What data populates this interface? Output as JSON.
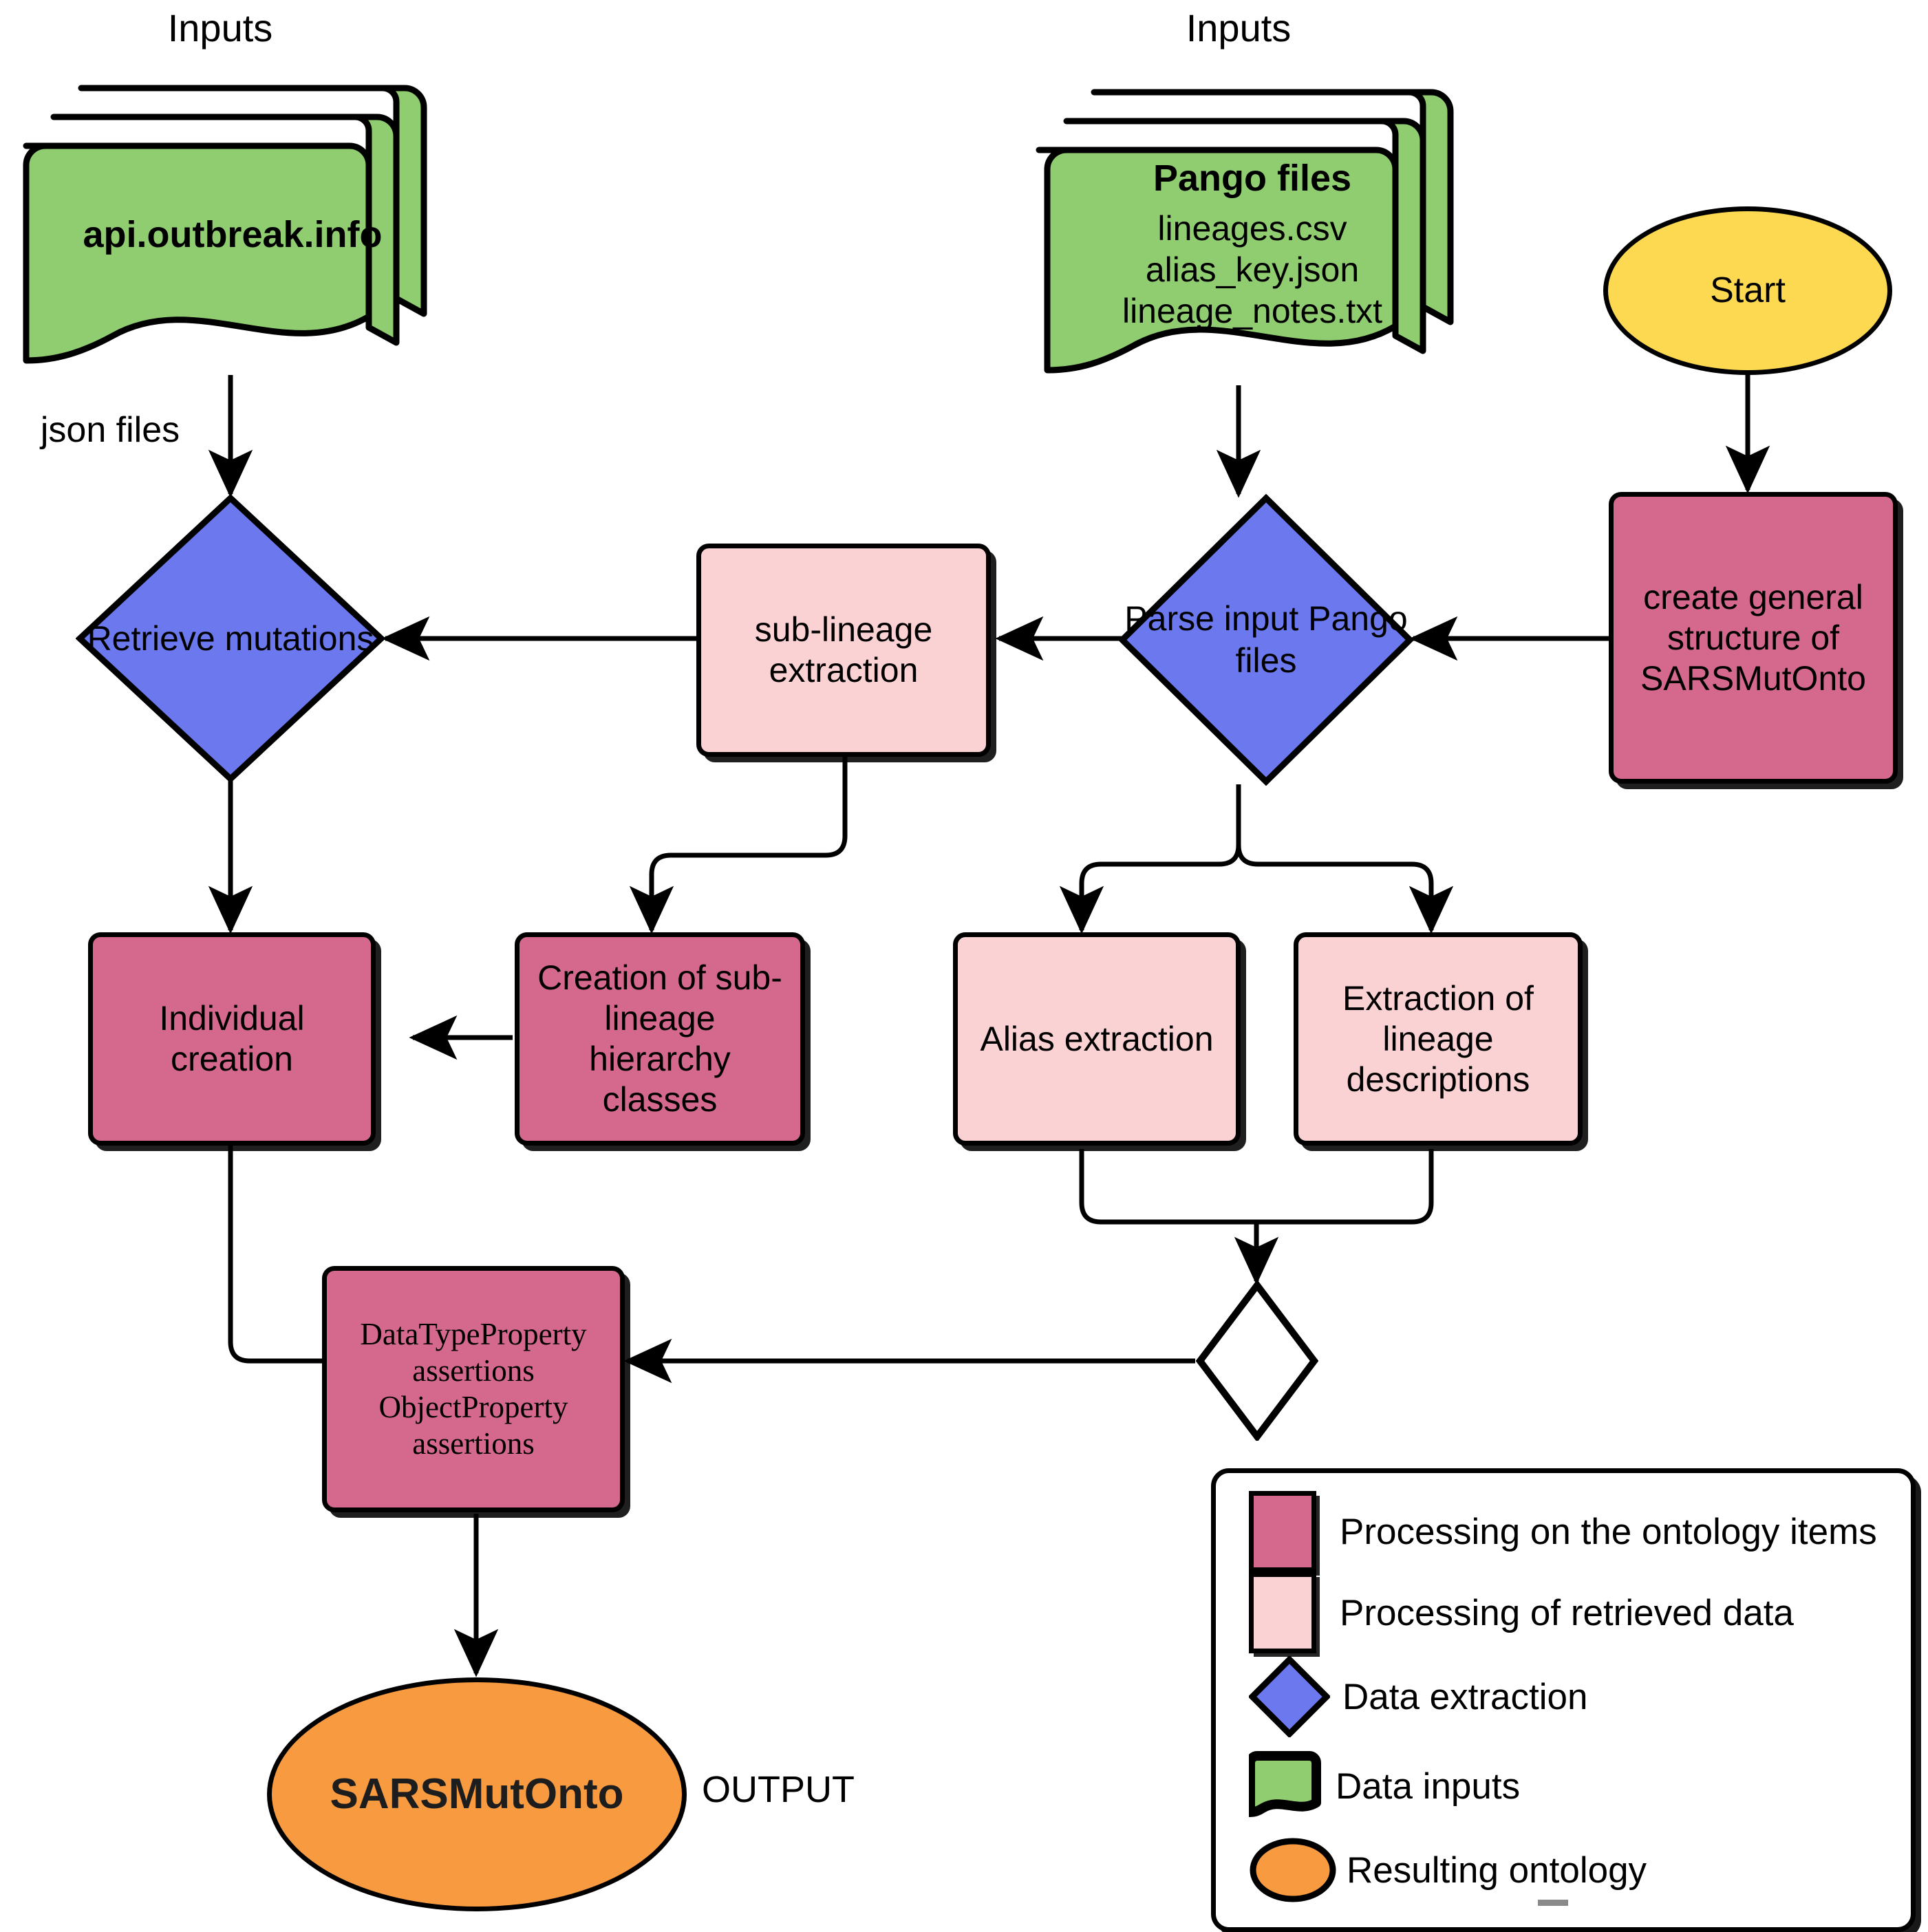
{
  "diagram": {
    "title": "SARSMutOnto construction workflow",
    "colors": {
      "ontology_processing": "#d4698d",
      "retrieved_processing": "#fbd2d4",
      "data_extraction": "#6b78ee",
      "data_input": "#90cc70",
      "start": "#fcd950",
      "result": "#f79a40",
      "stroke": "#000000"
    }
  },
  "inputs": {
    "left_caption": "Inputs",
    "right_caption": "Inputs",
    "outbreak": {
      "title": "api.outbreak.info"
    },
    "pango": {
      "title": "Pango files",
      "files": [
        "lineages.csv",
        "alias_key.json",
        "lineage_notes.txt"
      ]
    },
    "json_files_label": "json files"
  },
  "nodes": {
    "start": "Start",
    "create_structure": "create general structure of SARSMutOnto",
    "parse_pango": "Parse input Pango files",
    "sub_lineage_extraction": "sub-lineage extraction",
    "retrieve_mutations": "Retrieve mutations",
    "alias_extraction": "Alias extraction",
    "lineage_descriptions": "Extraction of lineage descriptions",
    "hierarchy_classes": "Creation of sub-lineage hierarchy classes",
    "individual_creation": "Individual creation",
    "assertions_line1": "DataTypeProperty",
    "assertions_line2": "assertions",
    "assertions_line3": "ObjectProperty",
    "assertions_line4": "assertions",
    "merge_diamond": "",
    "output_oval": "SARSMutOnto",
    "output_caption": "OUTPUT"
  },
  "legend": {
    "items": [
      {
        "label": "Processing on the ontology items",
        "shape": "square",
        "color": "#d4698d"
      },
      {
        "label": "Processing of retrieved data",
        "shape": "square",
        "color": "#fbd2d4"
      },
      {
        "label": "Data extraction",
        "shape": "diamond",
        "color": "#6b78ee"
      },
      {
        "label": "Data inputs",
        "shape": "document",
        "color": "#90cc70"
      },
      {
        "label": "Resulting ontology",
        "shape": "ellipse",
        "color": "#f79a40"
      }
    ]
  }
}
